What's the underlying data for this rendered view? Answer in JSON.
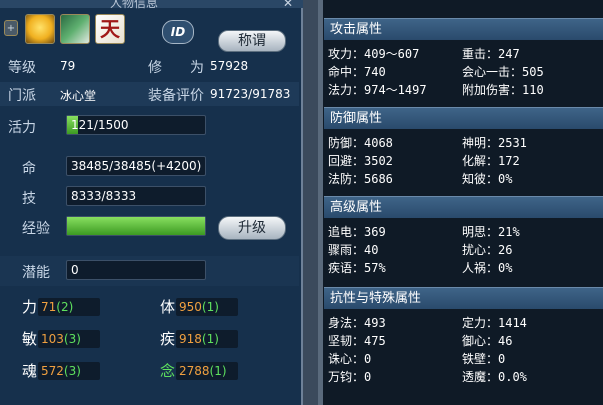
{
  "panel_title": "人物信息",
  "header": {
    "id_label": "ID",
    "title_button": "称谓"
  },
  "icons": [
    "plus-icon",
    "bulb-icon",
    "book-icon",
    "tianxia-icon"
  ],
  "tianxia_char": "天",
  "info": {
    "level_label": "等级",
    "level_value": "79",
    "cultivation_label": "修　　为",
    "cultivation_value": "57928",
    "sect_label": "门派",
    "sect_value": "冰心堂",
    "equip_label": "装备评价",
    "equip_value": "91723/91783"
  },
  "vitality": {
    "label": "活力",
    "value": "121/1500",
    "fill": 0.08
  },
  "hp": {
    "label": "命",
    "value": "38485/38485(+4200)"
  },
  "skill": {
    "label": "技",
    "value": "8333/8333"
  },
  "exp": {
    "label": "经验",
    "fill": 1.0,
    "button": "升级"
  },
  "potential": {
    "label": "潜能",
    "value": "0"
  },
  "attributes": [
    {
      "label": "力",
      "value": "71",
      "bonus": "(2)",
      "color": "#ffffff"
    },
    {
      "label": "体",
      "value": "950",
      "bonus": "(1)",
      "color": "#ffffff"
    },
    {
      "label": "敏",
      "value": "103",
      "bonus": "(3)",
      "color": "#ffffff"
    },
    {
      "label": "疾",
      "value": "918",
      "bonus": "(1)",
      "color": "#ffffff"
    },
    {
      "label": "魂",
      "value": "572",
      "bonus": "(3)",
      "color": "#ffffff"
    },
    {
      "label": "念",
      "value": "2788",
      "bonus": "(1)",
      "color": "#5ee05e"
    }
  ],
  "sections": [
    {
      "title": "攻击属性",
      "stats": [
        [
          "攻力：409～607",
          "重击：247"
        ],
        [
          "命中：740",
          "会心一击：505"
        ],
        [
          "法力：974～1497",
          "附加伤害：110"
        ]
      ]
    },
    {
      "title": "防御属性",
      "stats": [
        [
          "防御：4068",
          "神明：2531"
        ],
        [
          "回避：3502",
          "化解：172"
        ],
        [
          "法防：5686",
          "知彼：0%"
        ]
      ]
    },
    {
      "title": "高级属性",
      "stats": [
        [
          "追电：369",
          "明思：21%"
        ],
        [
          "骤雨：40",
          "扰心：26"
        ],
        [
          "疾语：57%",
          "人祸：0%"
        ]
      ]
    },
    {
      "title": "抗性与特殊属性",
      "stats": [
        [
          "身法：493",
          "定力：1414"
        ],
        [
          "坚韧：475",
          "御心：46"
        ],
        [
          "诛心：0",
          "铁壁：0"
        ],
        [
          "万钧：0",
          "透魔：0.0%"
        ]
      ]
    }
  ]
}
